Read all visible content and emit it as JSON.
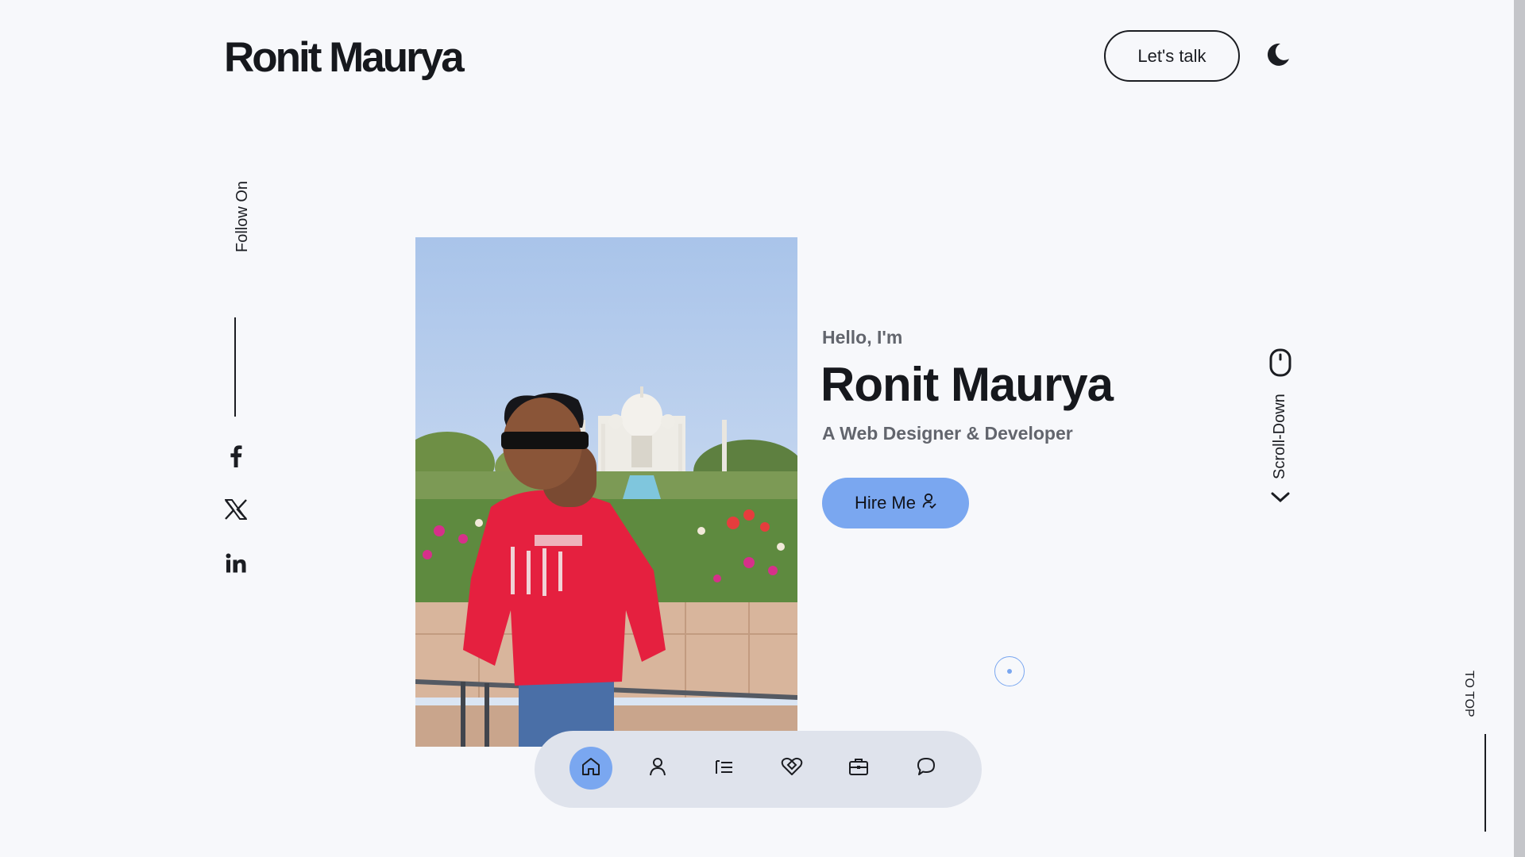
{
  "header": {
    "logo": "Ronit Maurya",
    "cta_label": "Let's talk",
    "theme_icon": "moon-icon"
  },
  "social": {
    "label": "Follow On",
    "links": [
      {
        "name": "facebook",
        "icon": "facebook-icon"
      },
      {
        "name": "x",
        "icon": "x-icon"
      },
      {
        "name": "linkedin",
        "icon": "linkedin-icon"
      }
    ]
  },
  "hero": {
    "greeting": "Hello, I'm",
    "name": "Ronit Maurya",
    "subtitle": "A Web Designer & Developer",
    "hire_label": "Hire Me",
    "photo_alt": "Portrait in red sweatshirt in front of the Taj Mahal"
  },
  "scroll": {
    "label": "Scroll-Down"
  },
  "to_top": {
    "label": "TO TOP"
  },
  "nav": {
    "items": [
      {
        "name": "home",
        "icon": "home-icon",
        "active": true
      },
      {
        "name": "about",
        "icon": "user-icon",
        "active": false
      },
      {
        "name": "skills",
        "icon": "list-icon",
        "active": false
      },
      {
        "name": "services",
        "icon": "heart-diamond-icon",
        "active": false
      },
      {
        "name": "portfolio",
        "icon": "briefcase-icon",
        "active": false
      },
      {
        "name": "contact",
        "icon": "chat-icon",
        "active": false
      }
    ]
  },
  "colors": {
    "background": "#f7f8fb",
    "accent": "#7aa7f0",
    "text": "#1b1d22",
    "muted": "#62656d",
    "nav_bg": "#dfe3ec"
  }
}
